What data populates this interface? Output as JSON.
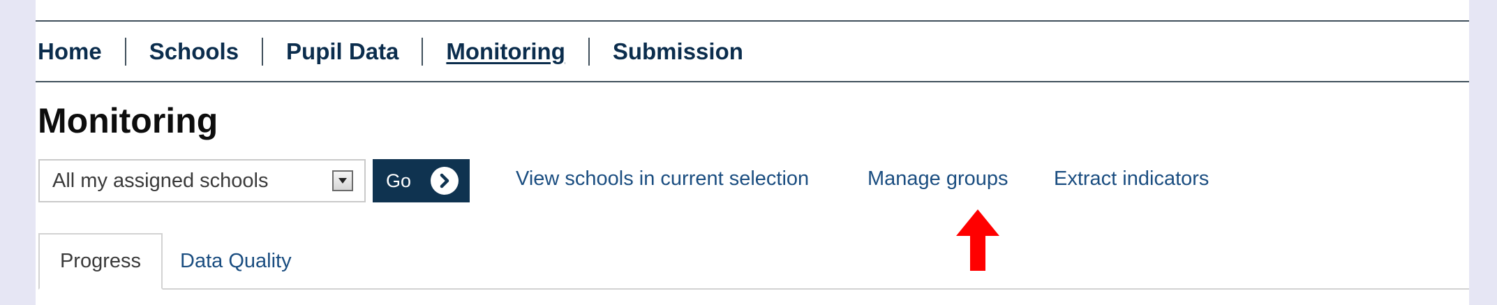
{
  "nav": {
    "items": [
      {
        "label": "Home"
      },
      {
        "label": "Schools"
      },
      {
        "label": "Pupil Data"
      },
      {
        "label": "Monitoring"
      },
      {
        "label": "Submission"
      }
    ]
  },
  "page": {
    "title": "Monitoring"
  },
  "toolbar": {
    "select_value": "All my assigned schools",
    "go_label": "Go",
    "links": {
      "view_schools": "View schools in current selection",
      "manage_groups": "Manage groups",
      "extract_indicators": "Extract indicators"
    }
  },
  "tabs": [
    {
      "label": "Progress"
    },
    {
      "label": "Data Quality"
    }
  ],
  "colors": {
    "nav_text": "#0b2d4d",
    "link": "#1a4d80",
    "go_button": "#0f3350",
    "annotation_arrow": "#ff0000",
    "background": "#e6e6f4"
  },
  "icons": {
    "select_arrow": "triangle-down-icon",
    "go": "chevron-right-circle-icon",
    "annotation": "red-arrow-up-icon"
  }
}
